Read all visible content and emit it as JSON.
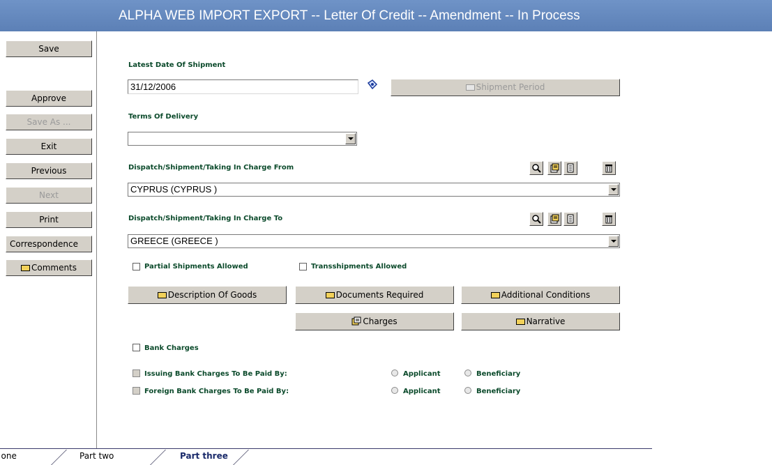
{
  "title": "ALPHA WEB IMPORT EXPORT --   Letter Of Credit -- Amendment -- In Process",
  "sidebar": {
    "save": "Save",
    "approve": "Approve",
    "save_as": "Save As ...",
    "exit": "Exit",
    "previous": "Previous",
    "next": "Next",
    "print": "Print",
    "correspondence": "Correspondence",
    "comments": "Comments"
  },
  "form": {
    "latest_date_label": "Latest Date Of Shipment",
    "latest_date_value": "31/12/2006",
    "shipment_period": "Shipment Period",
    "terms_label": "Terms Of Delivery",
    "terms_value": "",
    "from_label": "Dispatch/Shipment/Taking In Charge From",
    "from_value": "CYPRUS (CYPRUS )",
    "to_label": "Dispatch/Shipment/Taking In Charge To",
    "to_value": "GREECE (GREECE )",
    "partial_label": "Partial Shipments Allowed",
    "trans_label": "Transshipments Allowed",
    "desc_goods": "Description Of Goods",
    "docs_required": "Documents Required",
    "additional_conditions": "Additional Conditions",
    "charges": "Charges",
    "narrative": "Narrative",
    "bank_charges_label": "Bank Charges",
    "issuing_label": "Issuing Bank Charges To Be Paid By:",
    "foreign_label": "Foreign Bank Charges To Be Paid By:",
    "applicant": "Applicant",
    "beneficiary": "Beneficiary"
  },
  "tabs": [
    "Part one",
    "Part two",
    "Part three"
  ],
  "active_tab": "Part three"
}
